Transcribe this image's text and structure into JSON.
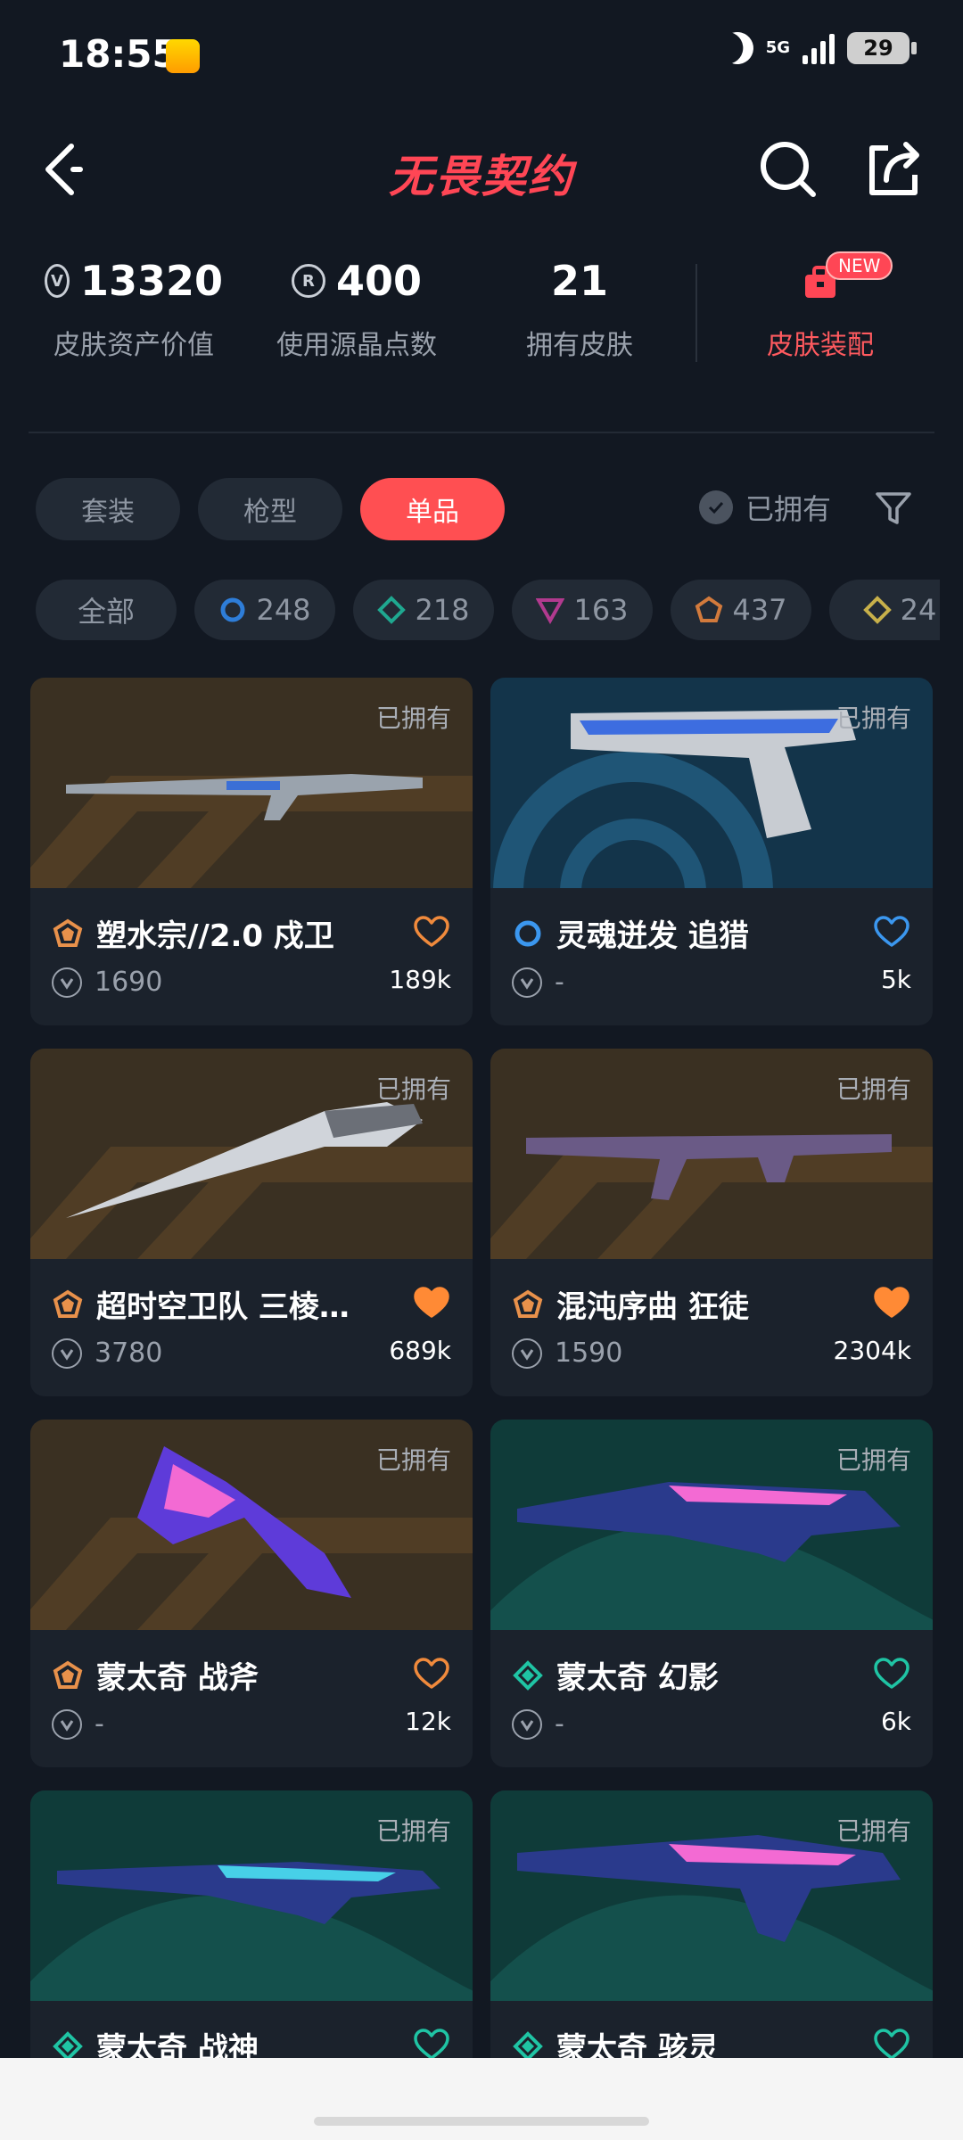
{
  "status": {
    "time": "18:55",
    "network": "5G",
    "battery": "29"
  },
  "header": {
    "title": "无畏契约"
  },
  "stats": [
    {
      "value": "13320",
      "label": "皮肤资产价值",
      "icon": "vp-coin-icon"
    },
    {
      "value": "400",
      "label": "使用源晶点数",
      "icon": "radianite-icon"
    },
    {
      "value": "21",
      "label": "拥有皮肤",
      "icon": ""
    }
  ],
  "loadout": {
    "label": "皮肤装配",
    "badge": "NEW"
  },
  "tabs": [
    {
      "label": "套装",
      "active": false
    },
    {
      "label": "枪型",
      "active": false
    },
    {
      "label": "单品",
      "active": true
    }
  ],
  "owned_filter": {
    "label": "已拥有"
  },
  "rarity": [
    {
      "label": "全部",
      "color": ""
    },
    {
      "label": "248",
      "color": "#2e7dd8"
    },
    {
      "label": "218",
      "color": "#1fa890"
    },
    {
      "label": "163",
      "color": "#b23a8f"
    },
    {
      "label": "437",
      "color": "#d27a3c"
    },
    {
      "label": "24",
      "color": "#c7b04a"
    }
  ],
  "cards": [
    {
      "name": "塑水宗//2.0 戍卫",
      "price": "1690",
      "likes": "189k",
      "owned": "已拥有",
      "tier_color": "#e8914b",
      "fav_filled": false,
      "fav_color": "#f08a3c",
      "bg": "gold"
    },
    {
      "name": "灵魂迸发 追猎",
      "price": "-",
      "likes": "5k",
      "owned": "已拥有",
      "tier_color": "#3b97ef",
      "fav_filled": false,
      "fav_color": "#3b97ef",
      "bg": "blue"
    },
    {
      "name": "超时空卫队 三棱…",
      "price": "3780",
      "likes": "689k",
      "owned": "已拥有",
      "tier_color": "#e8914b",
      "fav_filled": true,
      "fav_color": "#ff8a35",
      "bg": "gold"
    },
    {
      "name": "混沌序曲 狂徒",
      "price": "1590",
      "likes": "2304k",
      "owned": "已拥有",
      "tier_color": "#e8914b",
      "fav_filled": true,
      "fav_color": "#ff8a35",
      "bg": "gold"
    },
    {
      "name": "蒙太奇 战斧",
      "price": "-",
      "likes": "12k",
      "owned": "已拥有",
      "tier_color": "#e8914b",
      "fav_filled": false,
      "fav_color": "#f08a3c",
      "bg": "gold"
    },
    {
      "name": "蒙太奇 幻影",
      "price": "-",
      "likes": "6k",
      "owned": "已拥有",
      "tier_color": "#1fc4a4",
      "fav_filled": false,
      "fav_color": "#1fc4a4",
      "bg": "teal"
    },
    {
      "name": "蒙太奇 战神",
      "price": "",
      "likes": "",
      "owned": "已拥有",
      "tier_color": "#1fc4a4",
      "fav_filled": false,
      "fav_color": "#1fc4a4",
      "bg": "teal"
    },
    {
      "name": "蒙太奇 骇灵",
      "price": "",
      "likes": "",
      "owned": "已拥有",
      "tier_color": "#1fc4a4",
      "fav_filled": false,
      "fav_color": "#1fc4a4",
      "bg": "teal"
    }
  ]
}
